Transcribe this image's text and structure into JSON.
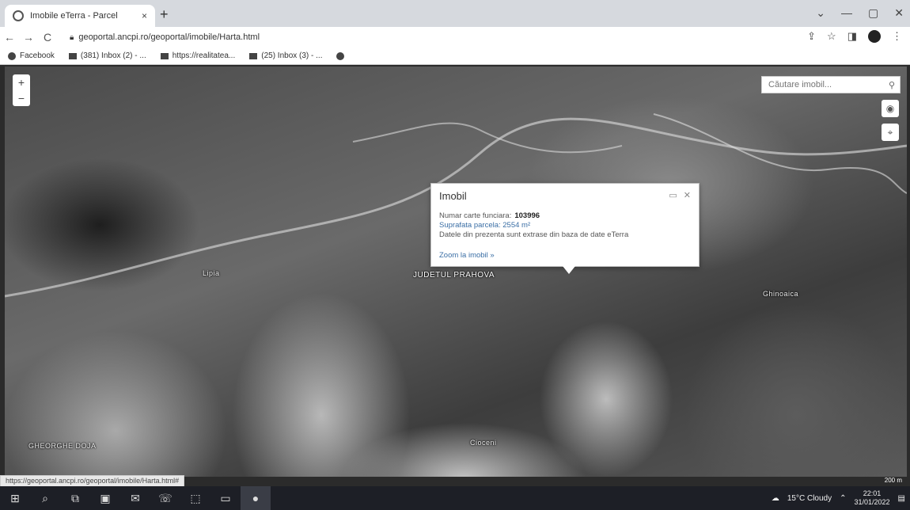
{
  "browser": {
    "tab_title": "Imobile eTerra - Parcel",
    "close_symbol": "×",
    "newtab_symbol": "+",
    "url": "geoportal.ancpi.ro/geoportal/imobile/Harta.html",
    "window_controls": [
      "⌄",
      "—",
      "▢",
      "✕"
    ]
  },
  "toolbar": {
    "back": "←",
    "forward": "→",
    "reload": "C",
    "share": "⇪",
    "star": "☆",
    "sidebar": "◨",
    "menu": "⋮"
  },
  "bookmarks": [
    {
      "label": "Facebook",
      "icon": "facebook-icon"
    },
    {
      "label": "(381) Inbox (2) - ...",
      "icon": "mail-icon"
    },
    {
      "label": "https://realitatea...",
      "icon": "news-icon"
    },
    {
      "label": "(25) Inbox (3) - ...",
      "icon": "mail-icon"
    },
    {
      "label": "",
      "icon": "facebook-icon"
    }
  ],
  "map": {
    "zoom_in": "+",
    "zoom_out": "−",
    "search_placeholder": "Căutare imobil...",
    "search_icon": "search-icon",
    "layers_icon": "◉",
    "locate_icon": "⌖",
    "labels": {
      "village_center": "JUDETUL PRAHOVA",
      "village_left": "Lipia",
      "village_right": "Ghinoaica",
      "village_bottom_left": "GHEORGHE DOJA",
      "village_bottom_mid": "Cioceni"
    },
    "scale_text": "200 m"
  },
  "popup": {
    "title": "Imobil",
    "row1_label": "Numar carte funciara:",
    "row1_value": "103996",
    "row2": "Suprafata parcela: 2554 m²",
    "row3": "Datele din prezenta sunt extrase din baza de date eTerra",
    "zoom_link": "Zoom la imobil »"
  },
  "status_url": "https://geoportal.ancpi.ro/geoportal/imobile/Harta.html#",
  "taskbar": {
    "items": [
      "⊞",
      "⌕",
      "⧉",
      "▣",
      "✉",
      "☏",
      "⬚",
      "▭",
      "●"
    ],
    "weather": "15°C Cloudy",
    "time": "22:01",
    "date": "31/01/2022"
  }
}
